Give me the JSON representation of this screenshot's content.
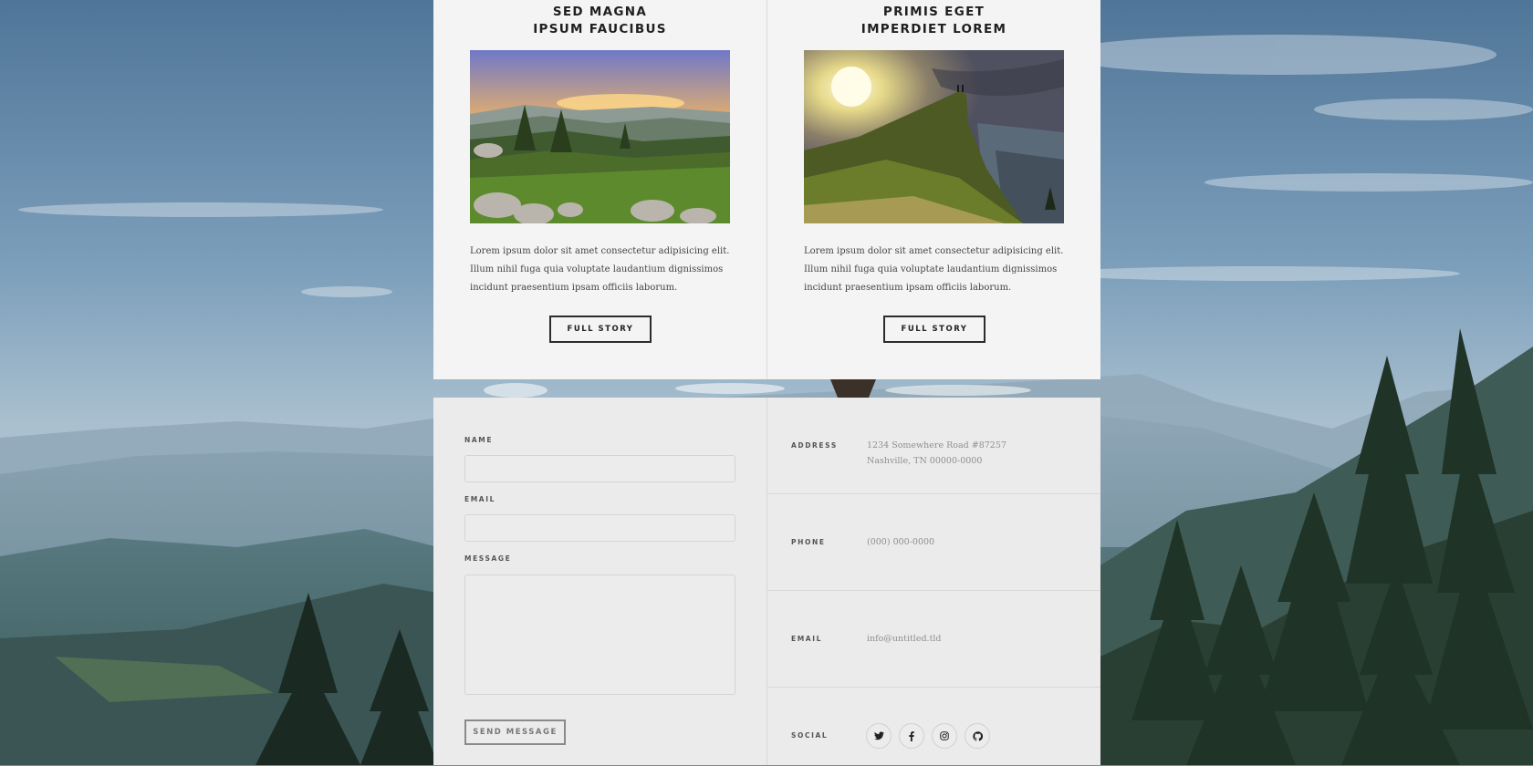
{
  "posts": [
    {
      "title_line1": "SED MAGNA",
      "title_line2": "IPSUM FAUCIBUS",
      "image_icon": "sunset-mountain-landscape",
      "text": "Lorem ipsum dolor sit amet consectetur adipisicing elit. Illum nihil fuga quia voluptate laudantium dignissimos incidunt praesentium ipsam officiis laborum.",
      "button_label": "FULL STORY"
    },
    {
      "title_line1": "PRIMIS EGET",
      "title_line2": "IMPERDIET LOREM",
      "image_icon": "cliff-sunrise-landscape",
      "text": "Lorem ipsum dolor sit amet consectetur adipisicing elit. Illum nihil fuga quia voluptate laudantium dignissimos incidunt praesentium ipsam officiis laborum.",
      "button_label": "FULL STORY"
    }
  ],
  "form": {
    "name_label": "NAME",
    "name_value": "",
    "email_label": "EMAIL",
    "email_value": "",
    "message_label": "MESSAGE",
    "message_value": "",
    "submit_label": "SEND MESSAGE"
  },
  "contact": {
    "address_label": "ADDRESS",
    "address_line1": "1234 Somewhere Road #87257",
    "address_line2": "Nashville, TN 00000-0000",
    "phone_label": "PHONE",
    "phone_value": "(000) 000-0000",
    "email_label": "EMAIL",
    "email_value": "info@untitled.tld",
    "social_label": "SOCIAL",
    "social_icons": [
      "twitter-icon",
      "facebook-icon",
      "instagram-icon",
      "github-icon"
    ]
  },
  "colors": {
    "card_background": "#f4f4f4",
    "footer_background": "#ebebeb",
    "heading": "#1f1f1f",
    "muted_text": "#8f8f8f"
  }
}
